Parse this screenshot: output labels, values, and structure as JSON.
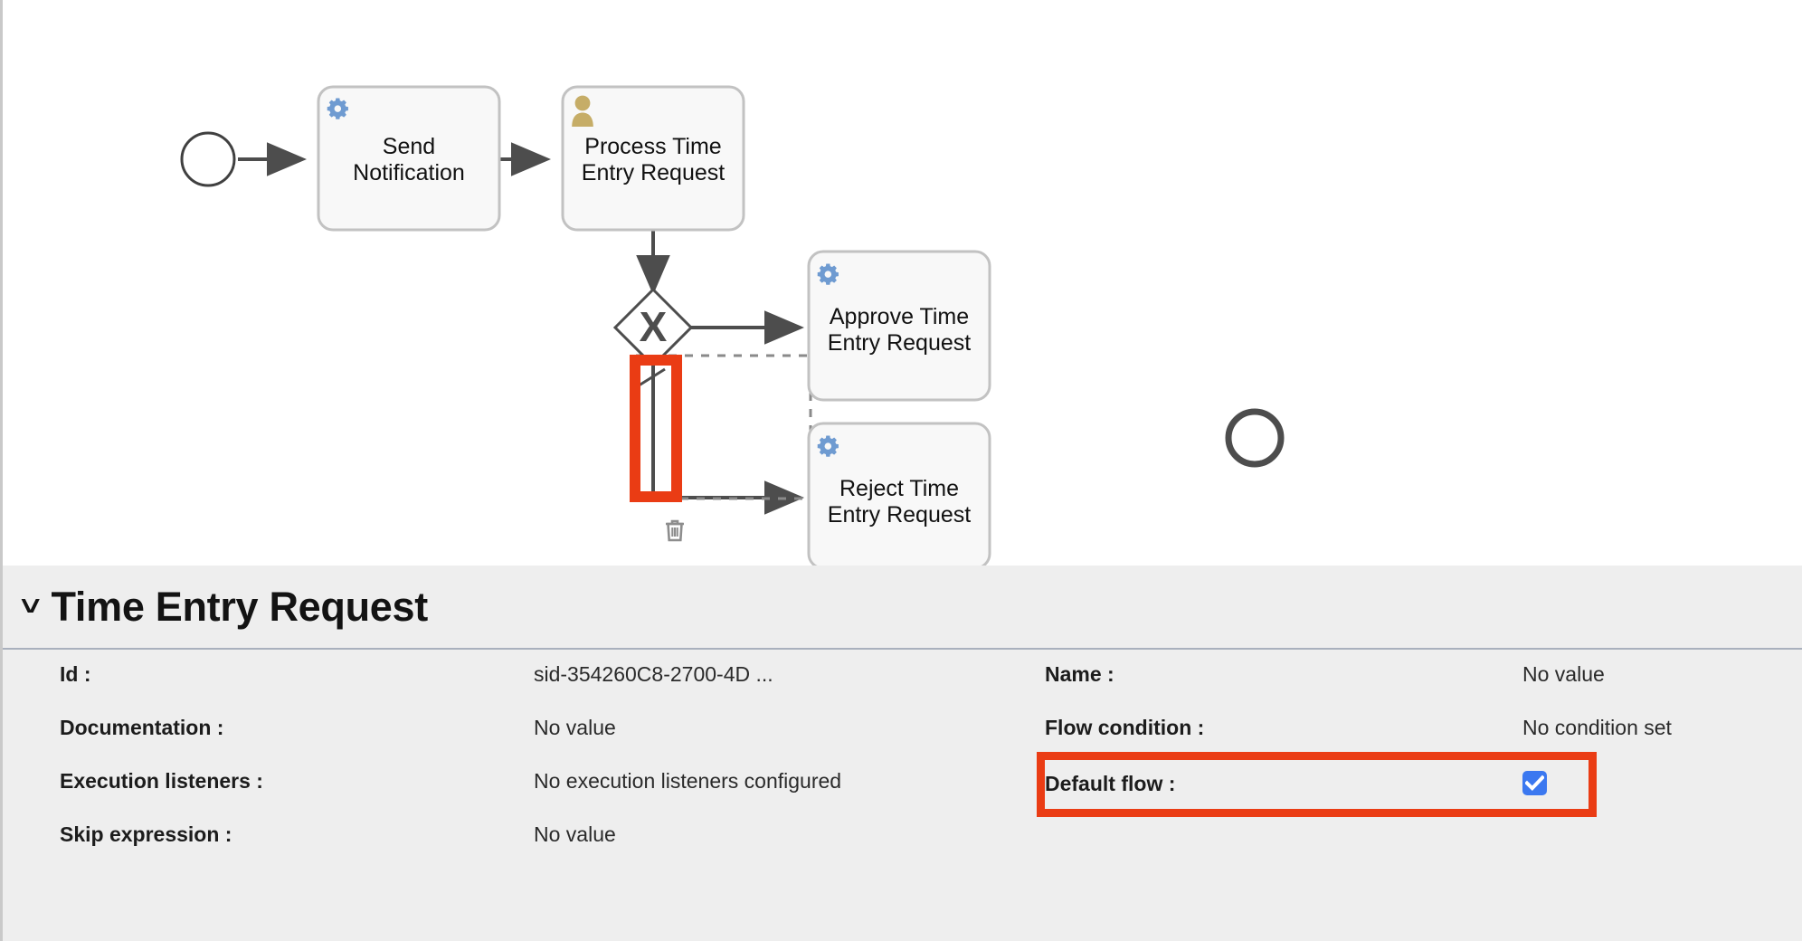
{
  "canvas": {
    "name": "bpmn-diagram-canvas",
    "start_event": {
      "name": "start-event"
    },
    "end_event": {
      "name": "end-event"
    },
    "tasks": [
      {
        "id": "send-notification",
        "label_line1": "Send",
        "label_line2": "Notification",
        "icon": "service-gear-icon",
        "icon_color": "#6f9bd1"
      },
      {
        "id": "process-time-entry-request",
        "label_line1": "Process Time",
        "label_line2": "Entry Request",
        "icon": "user-task-icon",
        "icon_color": "#c6ad67"
      },
      {
        "id": "approve-time-entry-request",
        "label_line1": "Approve Time",
        "label_line2": "Entry Request",
        "icon": "service-gear-icon",
        "icon_color": "#6f9bd1"
      },
      {
        "id": "reject-time-entry-request",
        "label_line1": "Reject Time",
        "label_line2": "Entry Request",
        "icon": "service-gear-icon",
        "icon_color": "#6f9bd1"
      }
    ],
    "gateway": {
      "name": "exclusive-gateway",
      "marker": "X"
    },
    "context_pad": {
      "delete_icon": "trash-icon"
    },
    "selection": {
      "type": "sequence-flow",
      "is_default_flow": true
    },
    "highlight_color": "#ea3c14"
  },
  "properties": {
    "header": {
      "collapse_icon": "chevron-down-icon",
      "title": "Time Entry Request"
    },
    "left_column": [
      {
        "label": "Id :",
        "value": "sid-354260C8-2700-4D ..."
      },
      {
        "label": "Documentation :",
        "value": "No value"
      },
      {
        "label": "Execution listeners :",
        "value": "No execution listeners configured"
      },
      {
        "label": "Skip expression :",
        "value": "No value"
      }
    ],
    "right_column": [
      {
        "label": "Name :",
        "value": "No value"
      },
      {
        "label": "Flow condition :",
        "value": "No condition set"
      }
    ],
    "default_flow": {
      "label": "Default flow :",
      "checked": true,
      "checkbox_color": "#3b78f0"
    }
  }
}
